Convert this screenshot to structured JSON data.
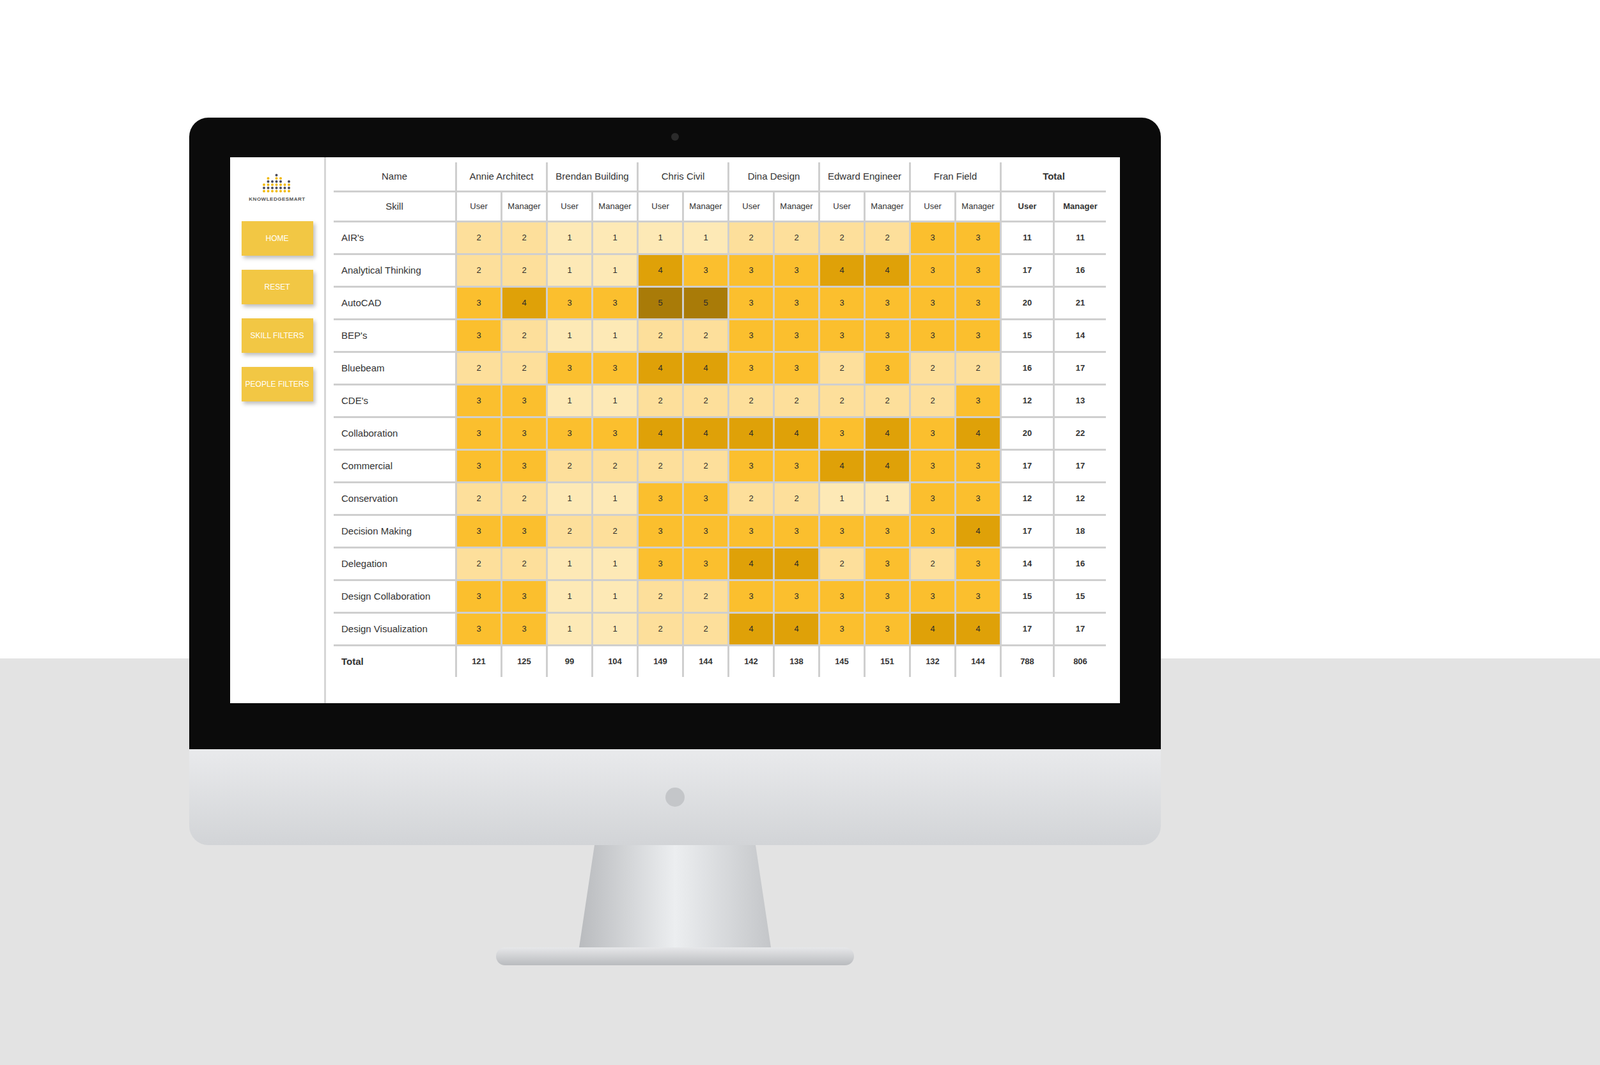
{
  "logo": {
    "text": "KNOWLEDGESMART"
  },
  "sidebar": {
    "buttons": [
      {
        "label": "HOME"
      },
      {
        "label": "RESET"
      },
      {
        "label": "SKILL FILTERS"
      },
      {
        "label": "PEOPLE FILTERS"
      }
    ]
  },
  "table": {
    "name_label": "Name",
    "skill_label": "Skill",
    "people": [
      {
        "name": "Annie Architect",
        "columns": [
          "User",
          "Manager"
        ]
      },
      {
        "name": "Brendan Building",
        "columns": [
          "User",
          "Manager"
        ]
      },
      {
        "name": "Chris Civil",
        "columns": [
          "User",
          "Manager"
        ]
      },
      {
        "name": "Dina Design",
        "columns": [
          "User",
          "Manager"
        ]
      },
      {
        "name": "Edward Engineer",
        "columns": [
          "User",
          "Manager"
        ]
      },
      {
        "name": "Fran Field",
        "columns": [
          "User",
          "Manager"
        ]
      }
    ],
    "total_label": "Total",
    "total_columns": [
      "User",
      "Manager"
    ],
    "rows": [
      {
        "skill": "AIR's",
        "values": [
          "2",
          "2",
          "1",
          "1",
          "1",
          "1",
          "2",
          "2",
          "2",
          "2",
          "3",
          "3"
        ],
        "totals": [
          "11",
          "11"
        ]
      },
      {
        "skill": "Analytical Thinking",
        "values": [
          "2",
          "2",
          "1",
          "1",
          "4",
          "3",
          "3",
          "3",
          "4",
          "4",
          "3",
          "3"
        ],
        "totals": [
          "17",
          "16"
        ]
      },
      {
        "skill": "AutoCAD",
        "values": [
          "3",
          "4",
          "3",
          "3",
          "5",
          "5",
          "3",
          "3",
          "3",
          "3",
          "3",
          "3"
        ],
        "totals": [
          "20",
          "21"
        ]
      },
      {
        "skill": "BEP's",
        "values": [
          "3",
          "2",
          "1",
          "1",
          "2",
          "2",
          "3",
          "3",
          "3",
          "3",
          "3",
          "3"
        ],
        "totals": [
          "15",
          "14"
        ]
      },
      {
        "skill": "Bluebeam",
        "values": [
          "2",
          "2",
          "3",
          "3",
          "4",
          "4",
          "3",
          "3",
          "2",
          "3",
          "2",
          "2"
        ],
        "totals": [
          "16",
          "17"
        ]
      },
      {
        "skill": "CDE's",
        "values": [
          "3",
          "3",
          "1",
          "1",
          "2",
          "2",
          "2",
          "2",
          "2",
          "2",
          "2",
          "3"
        ],
        "totals": [
          "12",
          "13"
        ]
      },
      {
        "skill": "Collaboration",
        "values": [
          "3",
          "3",
          "3",
          "3",
          "4",
          "4",
          "4",
          "4",
          "3",
          "4",
          "3",
          "4"
        ],
        "totals": [
          "20",
          "22"
        ]
      },
      {
        "skill": "Commercial",
        "values": [
          "3",
          "3",
          "2",
          "2",
          "2",
          "2",
          "3",
          "3",
          "4",
          "4",
          "3",
          "3"
        ],
        "totals": [
          "17",
          "17"
        ]
      },
      {
        "skill": "Conservation",
        "values": [
          "2",
          "2",
          "1",
          "1",
          "3",
          "3",
          "2",
          "2",
          "1",
          "1",
          "3",
          "3"
        ],
        "totals": [
          "12",
          "12"
        ]
      },
      {
        "skill": "Decision Making",
        "values": [
          "3",
          "3",
          "2",
          "2",
          "3",
          "3",
          "3",
          "3",
          "3",
          "3",
          "3",
          "4"
        ],
        "totals": [
          "17",
          "18"
        ]
      },
      {
        "skill": "Delegation",
        "values": [
          "2",
          "2",
          "1",
          "1",
          "3",
          "3",
          "4",
          "4",
          "2",
          "3",
          "2",
          "3"
        ],
        "totals": [
          "14",
          "16"
        ]
      },
      {
        "skill": "Design Collaboration",
        "values": [
          "3",
          "3",
          "1",
          "1",
          "2",
          "2",
          "3",
          "3",
          "3",
          "3",
          "3",
          "3"
        ],
        "totals": [
          "15",
          "15"
        ]
      },
      {
        "skill": "Design Visualization",
        "values": [
          "3",
          "3",
          "1",
          "1",
          "2",
          "2",
          "4",
          "4",
          "3",
          "3",
          "4",
          "4"
        ],
        "totals": [
          "17",
          "17"
        ]
      }
    ],
    "total_row": {
      "label": "Total",
      "values": [
        "121",
        "125",
        "99",
        "104",
        "149",
        "144",
        "142",
        "138",
        "145",
        "151",
        "132",
        "144"
      ],
      "totals": [
        "788",
        "806"
      ]
    }
  }
}
